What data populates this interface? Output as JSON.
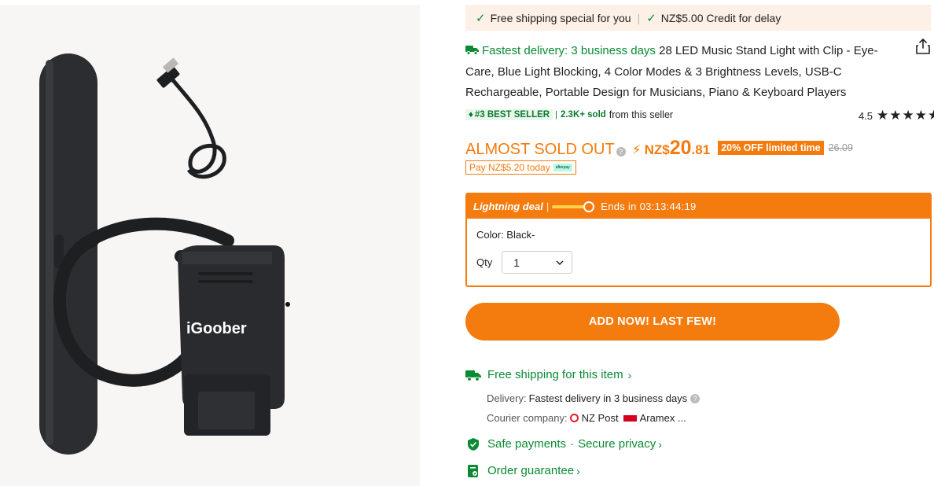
{
  "shipping_banner": {
    "free_shipping": "Free shipping special for you",
    "credit": "NZ$5.00 Credit for delay"
  },
  "title": {
    "fastest_delivery": "Fastest delivery: 3 business days",
    "product_name": "28 LED Music Stand Light with Clip - Eye-Care, Blue Light Blocking, 4 Color Modes & 3 Brightness Levels, USB-C Rechargeable, Portable Design for Musicians, Piano & Keyboard Players"
  },
  "badges": {
    "best_seller": "#3 BEST SELLER",
    "sold": "2.3K+ sold",
    "from_seller": "from this seller",
    "rating_value": "4.5",
    "rating_stars": 4.5
  },
  "price": {
    "almost_sold_out": "ALMOST SOLD OUT",
    "currency": "NZ$",
    "integer": "20",
    "decimal": ".81",
    "discount_badge": "20% OFF limited time",
    "original": "26.09",
    "pay_today": "Pay NZ$5.20 today",
    "afterpay_label": "afterpay"
  },
  "deal": {
    "label": "Lightning deal",
    "ends_in": "Ends in 03:13:44:19",
    "color": "Color: Black-",
    "qty_label": "Qty",
    "qty_value": "1"
  },
  "add_button": "ADD NOW! LAST FEW!",
  "shipping": {
    "free_shipping": "Free shipping for this item",
    "delivery_label": "Delivery:",
    "delivery_value": "Fastest delivery in 3 business days",
    "courier_label": "Courier company:",
    "courier_1": "NZ Post",
    "courier_2": "Aramex ..."
  },
  "safe_payments": "Safe payments",
  "secure_privacy": "Secure privacy",
  "order_guarantee": "Order guarantee",
  "product_brand": "iGoober",
  "colors": {
    "accent": "#f47b0e",
    "green": "#0a8a32",
    "banner_bg": "#fdf0e6"
  }
}
